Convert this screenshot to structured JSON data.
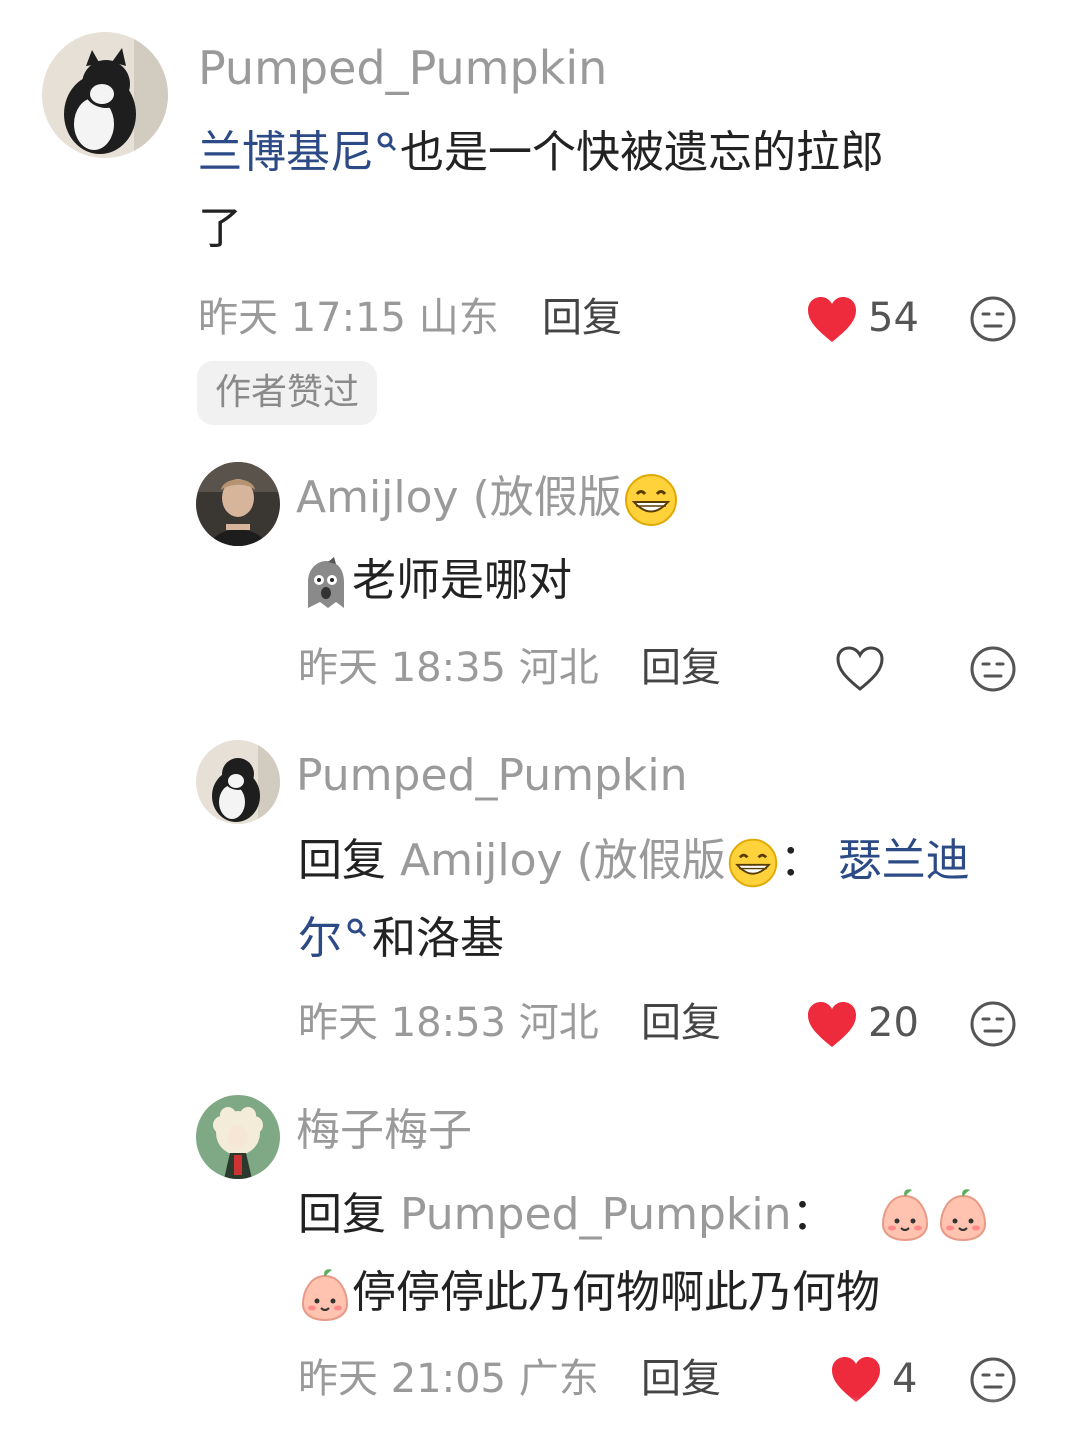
{
  "comments": [
    {
      "username": "Pumped_Pumpkin",
      "text_link": "兰博基尼",
      "text_rest": "也是一个快被遗忘的拉郎",
      "text_line2": "了",
      "date": "昨天 17:15",
      "location": "山东",
      "reply_label": "回复",
      "likes": "54",
      "liked": true,
      "badge": "作者赞过"
    },
    {
      "username": "Amijloy (放假版",
      "text": "老师是哪对",
      "date": "昨天 18:35",
      "location": "河北",
      "reply_label": "回复",
      "liked": false
    },
    {
      "username": "Pumped_Pumpkin",
      "reply_prefix": "回复",
      "reply_to": "Amijloy (放假版",
      "text_link1": "瑟兰迪",
      "text_link2": "尔",
      "text_rest": "和洛基",
      "date": "昨天 18:53",
      "location": "河北",
      "reply_label": "回复",
      "likes": "20",
      "liked": true
    },
    {
      "username": "梅子梅子",
      "reply_prefix": "回复",
      "reply_to": "Pumped_Pumpkin",
      "text": "停停停此乃何物啊此乃何物",
      "date": "昨天 21:05",
      "location": "广东",
      "reply_label": "回复",
      "likes": "4",
      "liked": true
    }
  ],
  "colors": {
    "link": "#2b4a86",
    "heart": "#ee2b3d",
    "muted": "#9a9a9a"
  },
  "icons": [
    "search-key-icon",
    "heart-icon",
    "dislike-face-icon",
    "grin-emoji-icon",
    "ghost-emoji-icon",
    "peach-emoji-icon"
  ]
}
